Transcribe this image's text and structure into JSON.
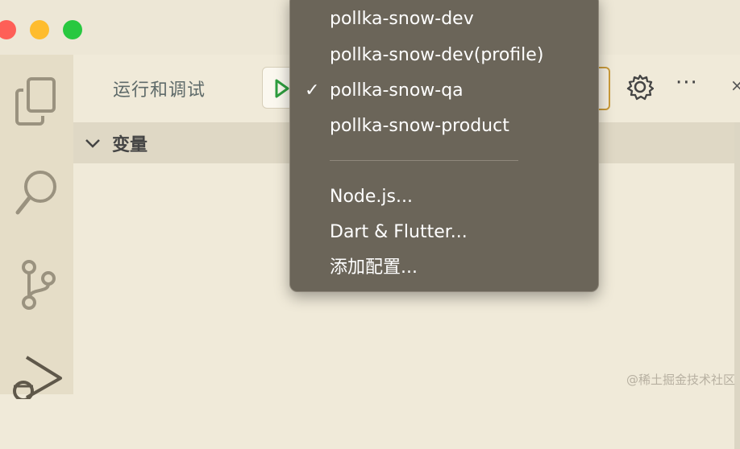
{
  "panel": {
    "title": "运行和调试",
    "section_label": "变量"
  },
  "menu": {
    "configs": [
      {
        "label": "pollka-snow-dev",
        "checked": false
      },
      {
        "label": "pollka-snow-dev(profile)",
        "checked": false
      },
      {
        "label": "pollka-snow-qa",
        "checked": true
      },
      {
        "label": "pollka-snow-product",
        "checked": false
      }
    ],
    "check_glyph": "✓",
    "actions": [
      {
        "label": "Node.js..."
      },
      {
        "label": "Dart & Flutter..."
      },
      {
        "label": "添加配置..."
      }
    ]
  },
  "toolbar": {
    "more_label": "···",
    "close_label": "×"
  },
  "watermark": "@稀土掘金技术社区",
  "icons": {
    "activity": [
      "explorer-icon",
      "search-icon",
      "source-control-icon",
      "run-debug-icon"
    ],
    "toolbar": [
      "play-icon",
      "gear-icon",
      "more-icon"
    ]
  },
  "colors": {
    "accent_green": "#2e9e3f",
    "focus_border": "#c99a3a",
    "menu_bg": "#6b6559"
  }
}
